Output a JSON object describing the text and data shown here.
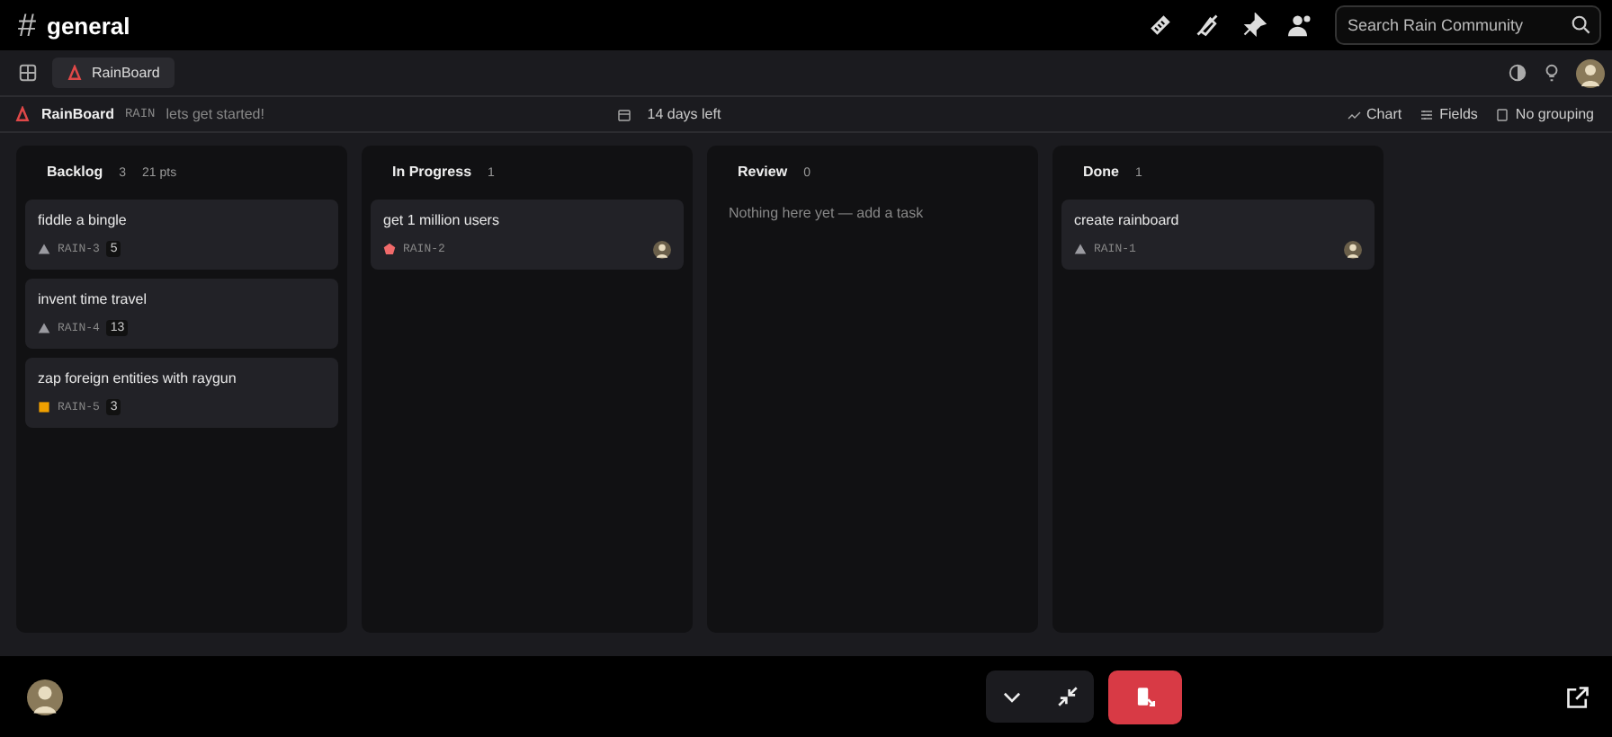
{
  "channel": {
    "icon": "#",
    "name": "general"
  },
  "search": {
    "placeholder": "Search Rain Community"
  },
  "tab": {
    "label": "RainBoard",
    "selected": true
  },
  "board_header": {
    "name": "RainBoard",
    "key": "RAIN",
    "description": "lets get started!",
    "time_left": "14 days left",
    "actions": [
      "Chart",
      "Fields",
      "No grouping"
    ]
  },
  "columns": [
    {
      "title": "Backlog",
      "count": "3",
      "points": "21 pts",
      "cards": [
        {
          "title": "fiddle a bingle",
          "kind": "triangle",
          "color": "#9a9aa0",
          "id": "RAIN-3",
          "estimate": "5",
          "assigned": false
        },
        {
          "title": "invent time travel",
          "kind": "triangle",
          "color": "#9a9aa0",
          "id": "RAIN-4",
          "estimate": "13",
          "assigned": false
        },
        {
          "title": "zap foreign entities with raygun",
          "kind": "square",
          "color": "#f0a000",
          "id": "RAIN-5",
          "estimate": "3",
          "assigned": false
        }
      ]
    },
    {
      "title": "In Progress",
      "count": "1",
      "cards": [
        {
          "title": "get 1 million users",
          "kind": "pentagon",
          "color": "#f06a6a",
          "id": "RAIN-2",
          "assigned": true
        }
      ]
    },
    {
      "title": "Review",
      "count": "0",
      "empty_text": "Nothing here yet — add a task"
    },
    {
      "title": "Done",
      "count": "1",
      "cards": [
        {
          "title": "create rainboard",
          "kind": "triangle",
          "color": "#9a9aa0",
          "id": "RAIN-1",
          "assigned": true
        }
      ]
    }
  ]
}
